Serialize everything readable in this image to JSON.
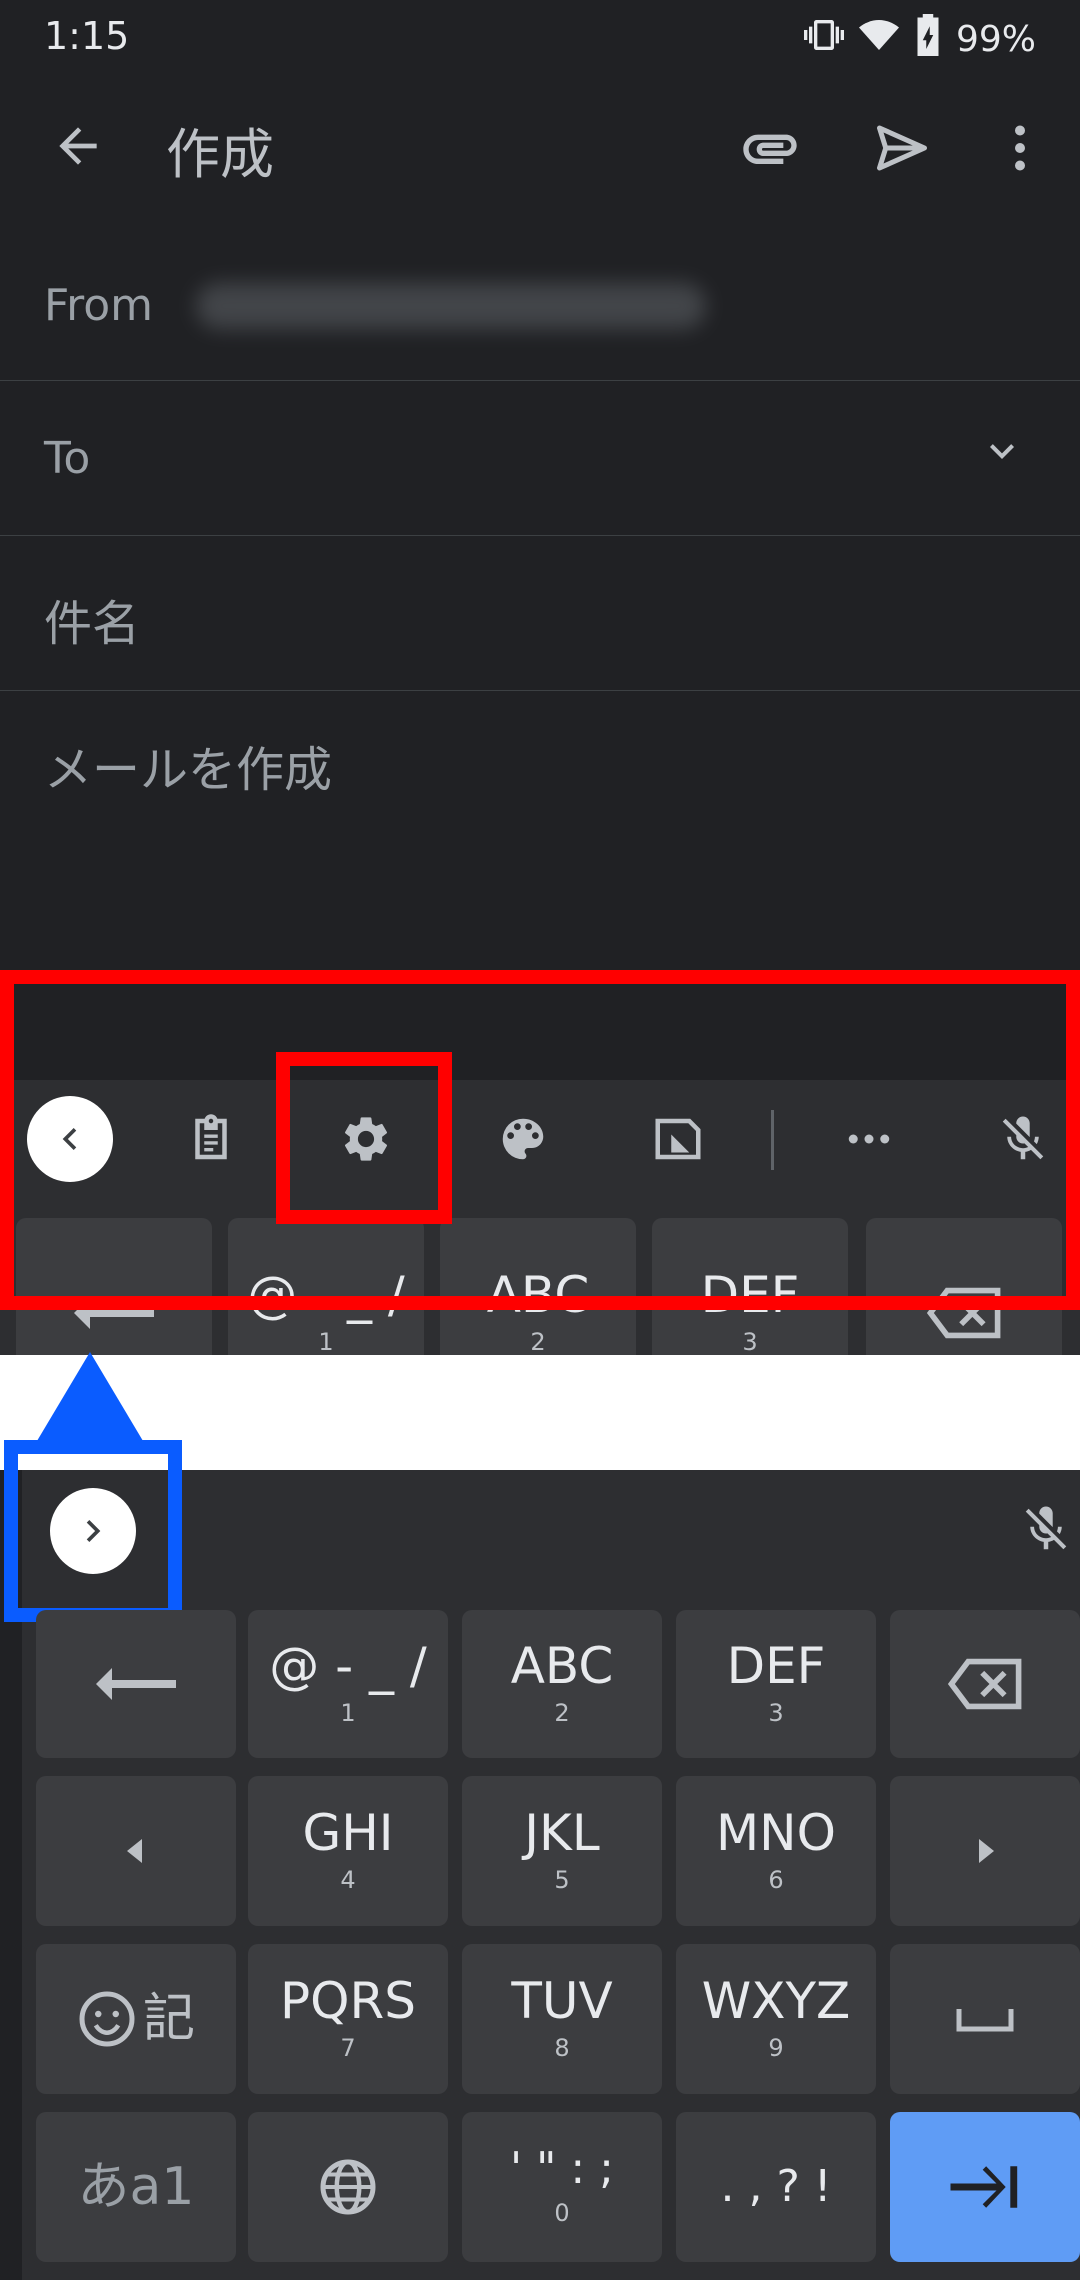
{
  "status_bar": {
    "time": "1:15",
    "battery": "99%"
  },
  "app_bar": {
    "title": "作成"
  },
  "compose": {
    "from_label": "From",
    "to_label": "To",
    "subject_placeholder": "件名",
    "body_placeholder": "メールを作成"
  },
  "keyboard_top": {
    "keys": [
      {
        "main": "@ - _ /",
        "sub": "1"
      },
      {
        "main": "ABC",
        "sub": "2"
      },
      {
        "main": "DEF",
        "sub": "3"
      }
    ]
  },
  "keyboard": {
    "rows": [
      [
        {
          "main": "@ - _ /",
          "sub": "1"
        },
        {
          "main": "ABC",
          "sub": "2"
        },
        {
          "main": "DEF",
          "sub": "3"
        }
      ],
      [
        {
          "main": "GHI",
          "sub": "4"
        },
        {
          "main": "JKL",
          "sub": "5"
        },
        {
          "main": "MNO",
          "sub": "6"
        }
      ],
      [
        {
          "main": "PQRS",
          "sub": "7"
        },
        {
          "main": "TUV",
          "sub": "8"
        },
        {
          "main": "WXYZ",
          "sub": "9"
        }
      ],
      [
        {
          "main": "' \" : ;",
          "sub": "0"
        },
        {
          "main": ". , ? !",
          "sub": ""
        }
      ]
    ],
    "emoji_key_label": "記",
    "mode_key_label": "あa1"
  },
  "colors": {
    "background": "#202124",
    "keyboard_bg": "#2d2e31",
    "key": "#3c3d40",
    "accent_key": "#5f9cf5",
    "highlight_red": "#ff0000",
    "highlight_blue": "#0a5cff"
  }
}
